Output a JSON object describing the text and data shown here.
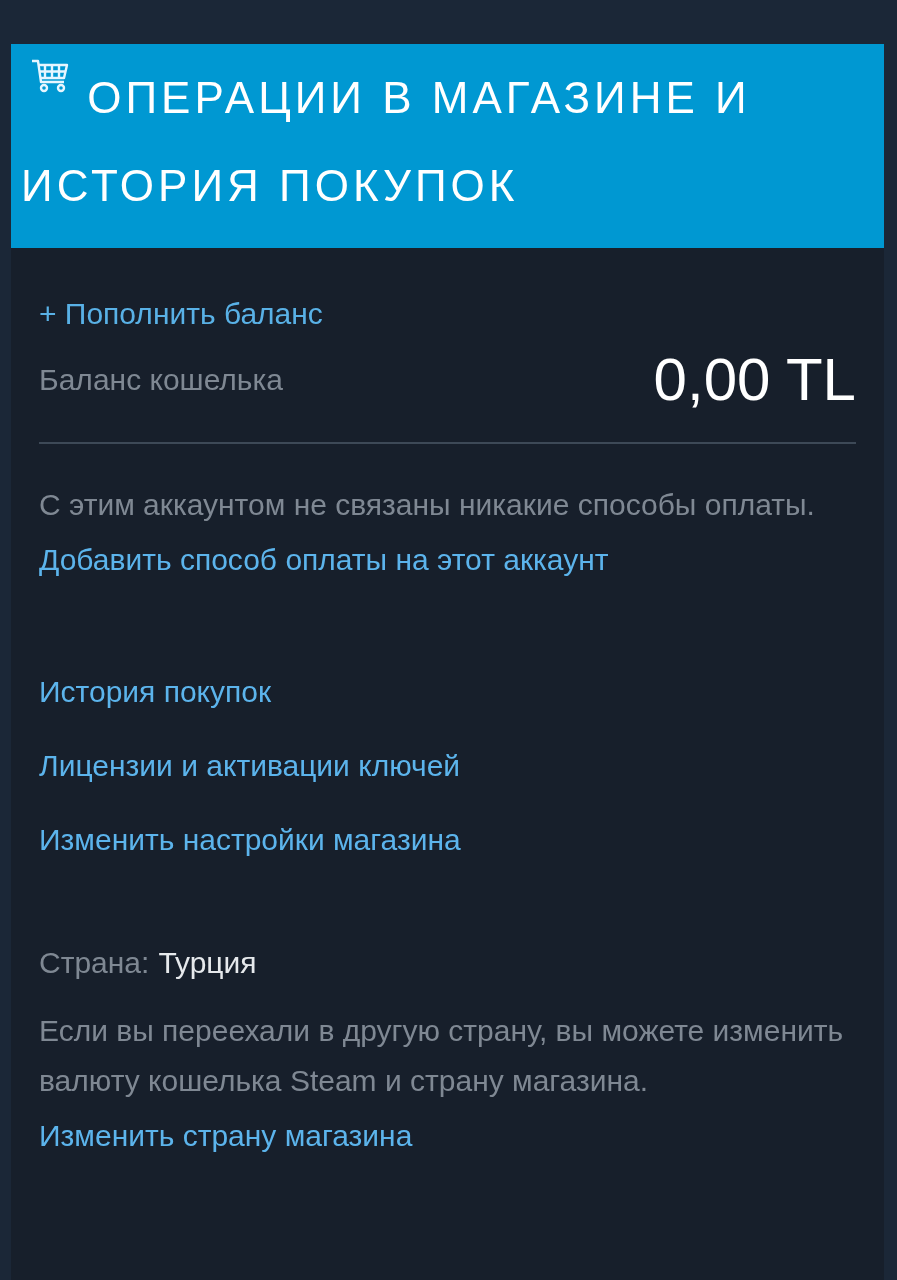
{
  "header": {
    "title": "ОПЕРАЦИИ В МАГАЗИНЕ И ИСТОРИЯ ПОКУПОК"
  },
  "wallet": {
    "add_funds_link": "+ Пополнить баланс",
    "balance_label": "Баланс кошелька",
    "balance": "0,00 TL"
  },
  "payment": {
    "notice": "С этим аккаунтом не связаны никакие способы оплаты.",
    "add_link": "Добавить способ оплаты на этот аккаунт"
  },
  "links": [
    "История покупок",
    "Лицензии и активации ключей",
    "Изменить настройки магазина"
  ],
  "country": {
    "label": "Страна:",
    "value": "Турция",
    "notice": "Если вы переехали в другую страну, вы можете изменить валюту кошелька Steam и страну магазина.",
    "change_link": "Изменить страну магазина"
  }
}
